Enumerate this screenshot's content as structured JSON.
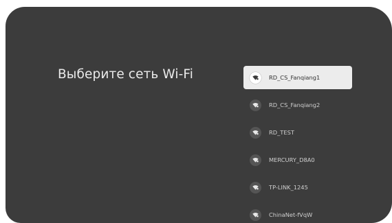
{
  "screen": {
    "title": "Выберите сеть Wi-Fi"
  },
  "networks": [
    {
      "name": "RD_CS_Fanqiang1",
      "focused": true,
      "icon": "wifi-icon"
    },
    {
      "name": "RD_CS_Fanqiang2",
      "focused": false,
      "icon": "wifi-icon"
    },
    {
      "name": "RD_TEST",
      "focused": false,
      "icon": "wifi-icon"
    },
    {
      "name": "MERCURY_D8A0",
      "focused": false,
      "icon": "wifi-icon"
    },
    {
      "name": "TP-LINK_1245",
      "focused": false,
      "icon": "wifi-icon"
    },
    {
      "name": "ChinaNet-fVqW",
      "focused": false,
      "icon": "wifi-icon"
    }
  ],
  "colors": {
    "background": "#3c3c3c",
    "focused_item": "#ececec",
    "text": "#d0d0d0"
  }
}
